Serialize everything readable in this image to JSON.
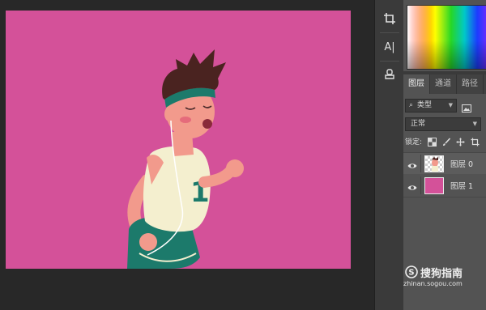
{
  "canvas": {
    "background_color": "#d45199",
    "jersey_number": "1"
  },
  "toolbar": {
    "tools": [
      "crop-tool",
      "vertical-type-tool",
      "stamp-tool"
    ],
    "type_tool_glyph": "A|"
  },
  "layers_panel": {
    "tabs": [
      {
        "label": "图层",
        "active": true
      },
      {
        "label": "通道",
        "active": false
      },
      {
        "label": "路径",
        "active": false
      }
    ],
    "filter": {
      "label": "类型",
      "search_icon": "⌕"
    },
    "blend_mode": "正常",
    "lock_label": "锁定:",
    "layers": [
      {
        "name": "图层 0",
        "visible": true,
        "selected": true
      },
      {
        "name": "图层 1",
        "visible": true,
        "selected": false
      }
    ]
  },
  "watermark": {
    "logo_letter": "S",
    "title": "搜狗指南",
    "url": "zhinan.sogou.com"
  },
  "colors": {
    "canvas": "#d45199",
    "panel": "#535353",
    "workspace": "#282828",
    "accent_teal": "#1c7a6b"
  }
}
